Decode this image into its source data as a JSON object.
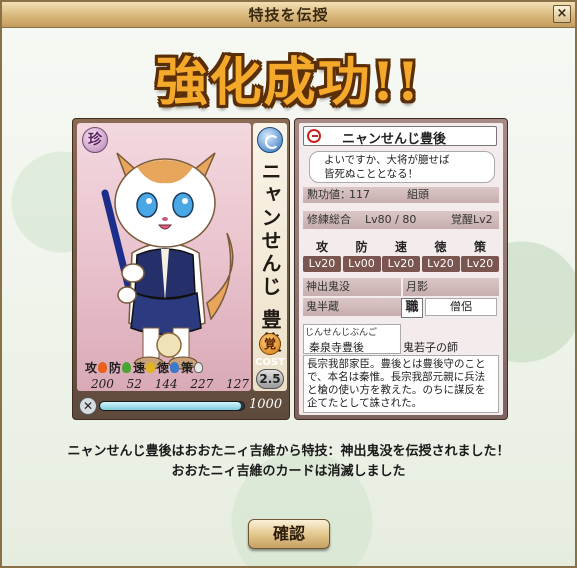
{
  "window": {
    "title": "特技を伝授",
    "close_label": "×"
  },
  "headline": "強化成功!!",
  "card": {
    "rarity": "珍",
    "name_vertical": "ニャンせんじ 豊後",
    "awaken_mark": "覚",
    "cost_label": "COST",
    "cost_value": "2.5",
    "stat_labels": [
      "攻",
      "防",
      "速",
      "徳",
      "策"
    ],
    "stat_values": [
      "200",
      "52",
      "144",
      "227",
      "127"
    ],
    "level_value": "1000",
    "level_fraction": 0.98
  },
  "info": {
    "name": "ニャンせんじ豊後",
    "quote": "よいですか、大将が臆せば\n皆死ぬこととなる！",
    "merit_label": "勲功値：",
    "merit_value": "117",
    "rank": "組頭",
    "training_label": "修練総合",
    "training_value": "Lv80 / 80",
    "awaken_label": "覚醒Lv2",
    "levels": [
      {
        "label": "攻",
        "value": "Lv20"
      },
      {
        "label": "防",
        "value": "Lv00"
      },
      {
        "label": "速",
        "value": "Lv20"
      },
      {
        "label": "徳",
        "value": "Lv20"
      },
      {
        "label": "策",
        "value": "Lv20"
      }
    ],
    "skill1": "神出鬼没",
    "skill2": "月影",
    "skill3": "鬼半蔵",
    "job_icon": "職",
    "job_name": "僧侶",
    "relation_reading": "じんせんじぶんご",
    "relation_name": "秦泉寺豊後",
    "relation_role": "鬼若子の師",
    "bio": "長宗我部家臣。豊後とは豊後守のことで、本名は秦惟。長宗我部元親に兵法と槍の使い方を教えた。のちに謀反を企てたとして誅された。"
  },
  "messages": {
    "line1": "ニャンせんじ豊後はおおたニィ吉維から特技：神出鬼没を伝授されました！",
    "line2": "おおたニィ吉維のカードは消滅しました"
  },
  "confirm_label": "確認",
  "colors": {
    "headline": "#f4a92a",
    "headline_outline": "#5a2f08",
    "title_bar": "#d8b77b"
  }
}
